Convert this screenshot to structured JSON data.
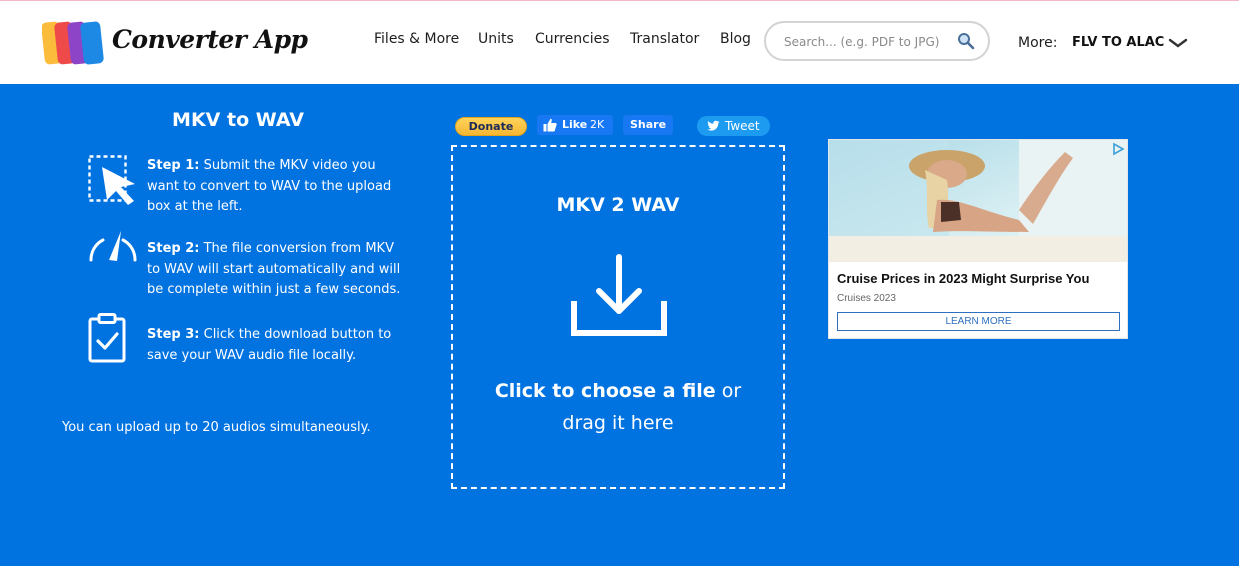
{
  "header": {
    "brand": "Converter App",
    "nav": [
      "Files & More",
      "Units",
      "Currencies",
      "Translator",
      "Blog"
    ],
    "search": {
      "placeholder": "Search... (e.g. PDF to JPG)",
      "value": ""
    },
    "more_label": "More:",
    "more_selected": "FLV TO ALAC"
  },
  "left": {
    "title": "MKV to WAV",
    "steps": [
      {
        "label": "Step 1:",
        "text": " Submit the MKV video you want to convert to WAV to the upload box at the left."
      },
      {
        "label": "Step 2:",
        "text": " The file conversion from MKV to WAV will start automatically and will be complete within just a few seconds."
      },
      {
        "label": "Step 3:",
        "text": " Click the download button to save your WAV audio file locally."
      }
    ],
    "upload_note": "You can upload up to 20 audios simultaneously."
  },
  "social": {
    "donate": "Donate",
    "like": "Like",
    "like_count": "2K",
    "share": "Share",
    "tweet": "Tweet"
  },
  "dropzone": {
    "title": "MKV 2 WAV",
    "cta_bold": "Click to choose a file",
    "cta_rest": " or",
    "cta_line2": "drag it here"
  },
  "ad": {
    "title": "Cruise Prices in 2023 Might Surprise You",
    "source": "Cruises 2023",
    "cta": "LEARN MORE"
  },
  "colors": {
    "page_bg": "#0073e1",
    "header_bg": "#ffffff",
    "donate": "#f7b733",
    "facebook": "#1877f2",
    "twitter": "#1d9bf0"
  }
}
